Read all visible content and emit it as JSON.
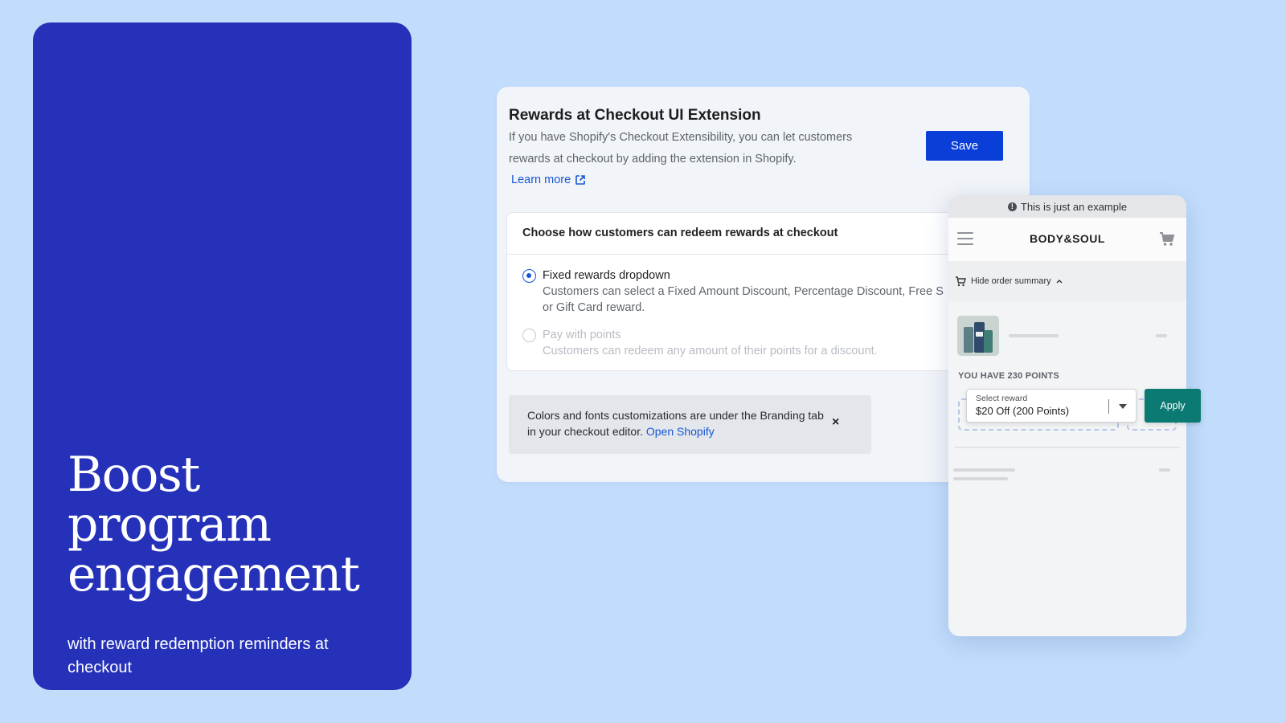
{
  "hero": {
    "title": "Boost\nprogram\nengagement",
    "subtitle": "with reward redemption reminders at checkout"
  },
  "admin": {
    "title": "Rewards at Checkout UI Extension",
    "description": "If you have Shopify's Checkout Extensibility, you can let customers rewards at checkout by adding the extension in Shopify.",
    "learn_more": "Learn more",
    "save_label": "Save",
    "redeem": {
      "heading": "Choose how customers can redeem rewards at checkout",
      "options": [
        {
          "label": "Fixed rewards dropdown",
          "description_line1": "Customers can select a Fixed Amount Discount, Percentage Discount, Free S",
          "description_line2": "or Gift Card reward.",
          "selected": true,
          "disabled": false
        },
        {
          "label": "Pay with points",
          "description_line1": "Customers can redeem any amount of their points for a discount.",
          "selected": false,
          "disabled": true
        }
      ]
    },
    "banner": {
      "text": "Colors and fonts customizations are under the Branding tab in your checkout editor.",
      "link": "Open Shopify",
      "close": "×"
    }
  },
  "checkout_preview": {
    "example_notice": "This is just an example",
    "brand": "BODY&SOUL",
    "order_summary_toggle": "Hide order summary",
    "points_label": "YOU HAVE 230 POINTS",
    "select": {
      "caption": "Select reward",
      "value": "$20 Off (200 Points)"
    },
    "apply_label": "Apply"
  },
  "colors": {
    "background": "#c2ddfc",
    "hero": "#2431b8",
    "primary_button": "#0a3ed9",
    "apply_button": "#0b7a72",
    "link": "#1757d6"
  }
}
